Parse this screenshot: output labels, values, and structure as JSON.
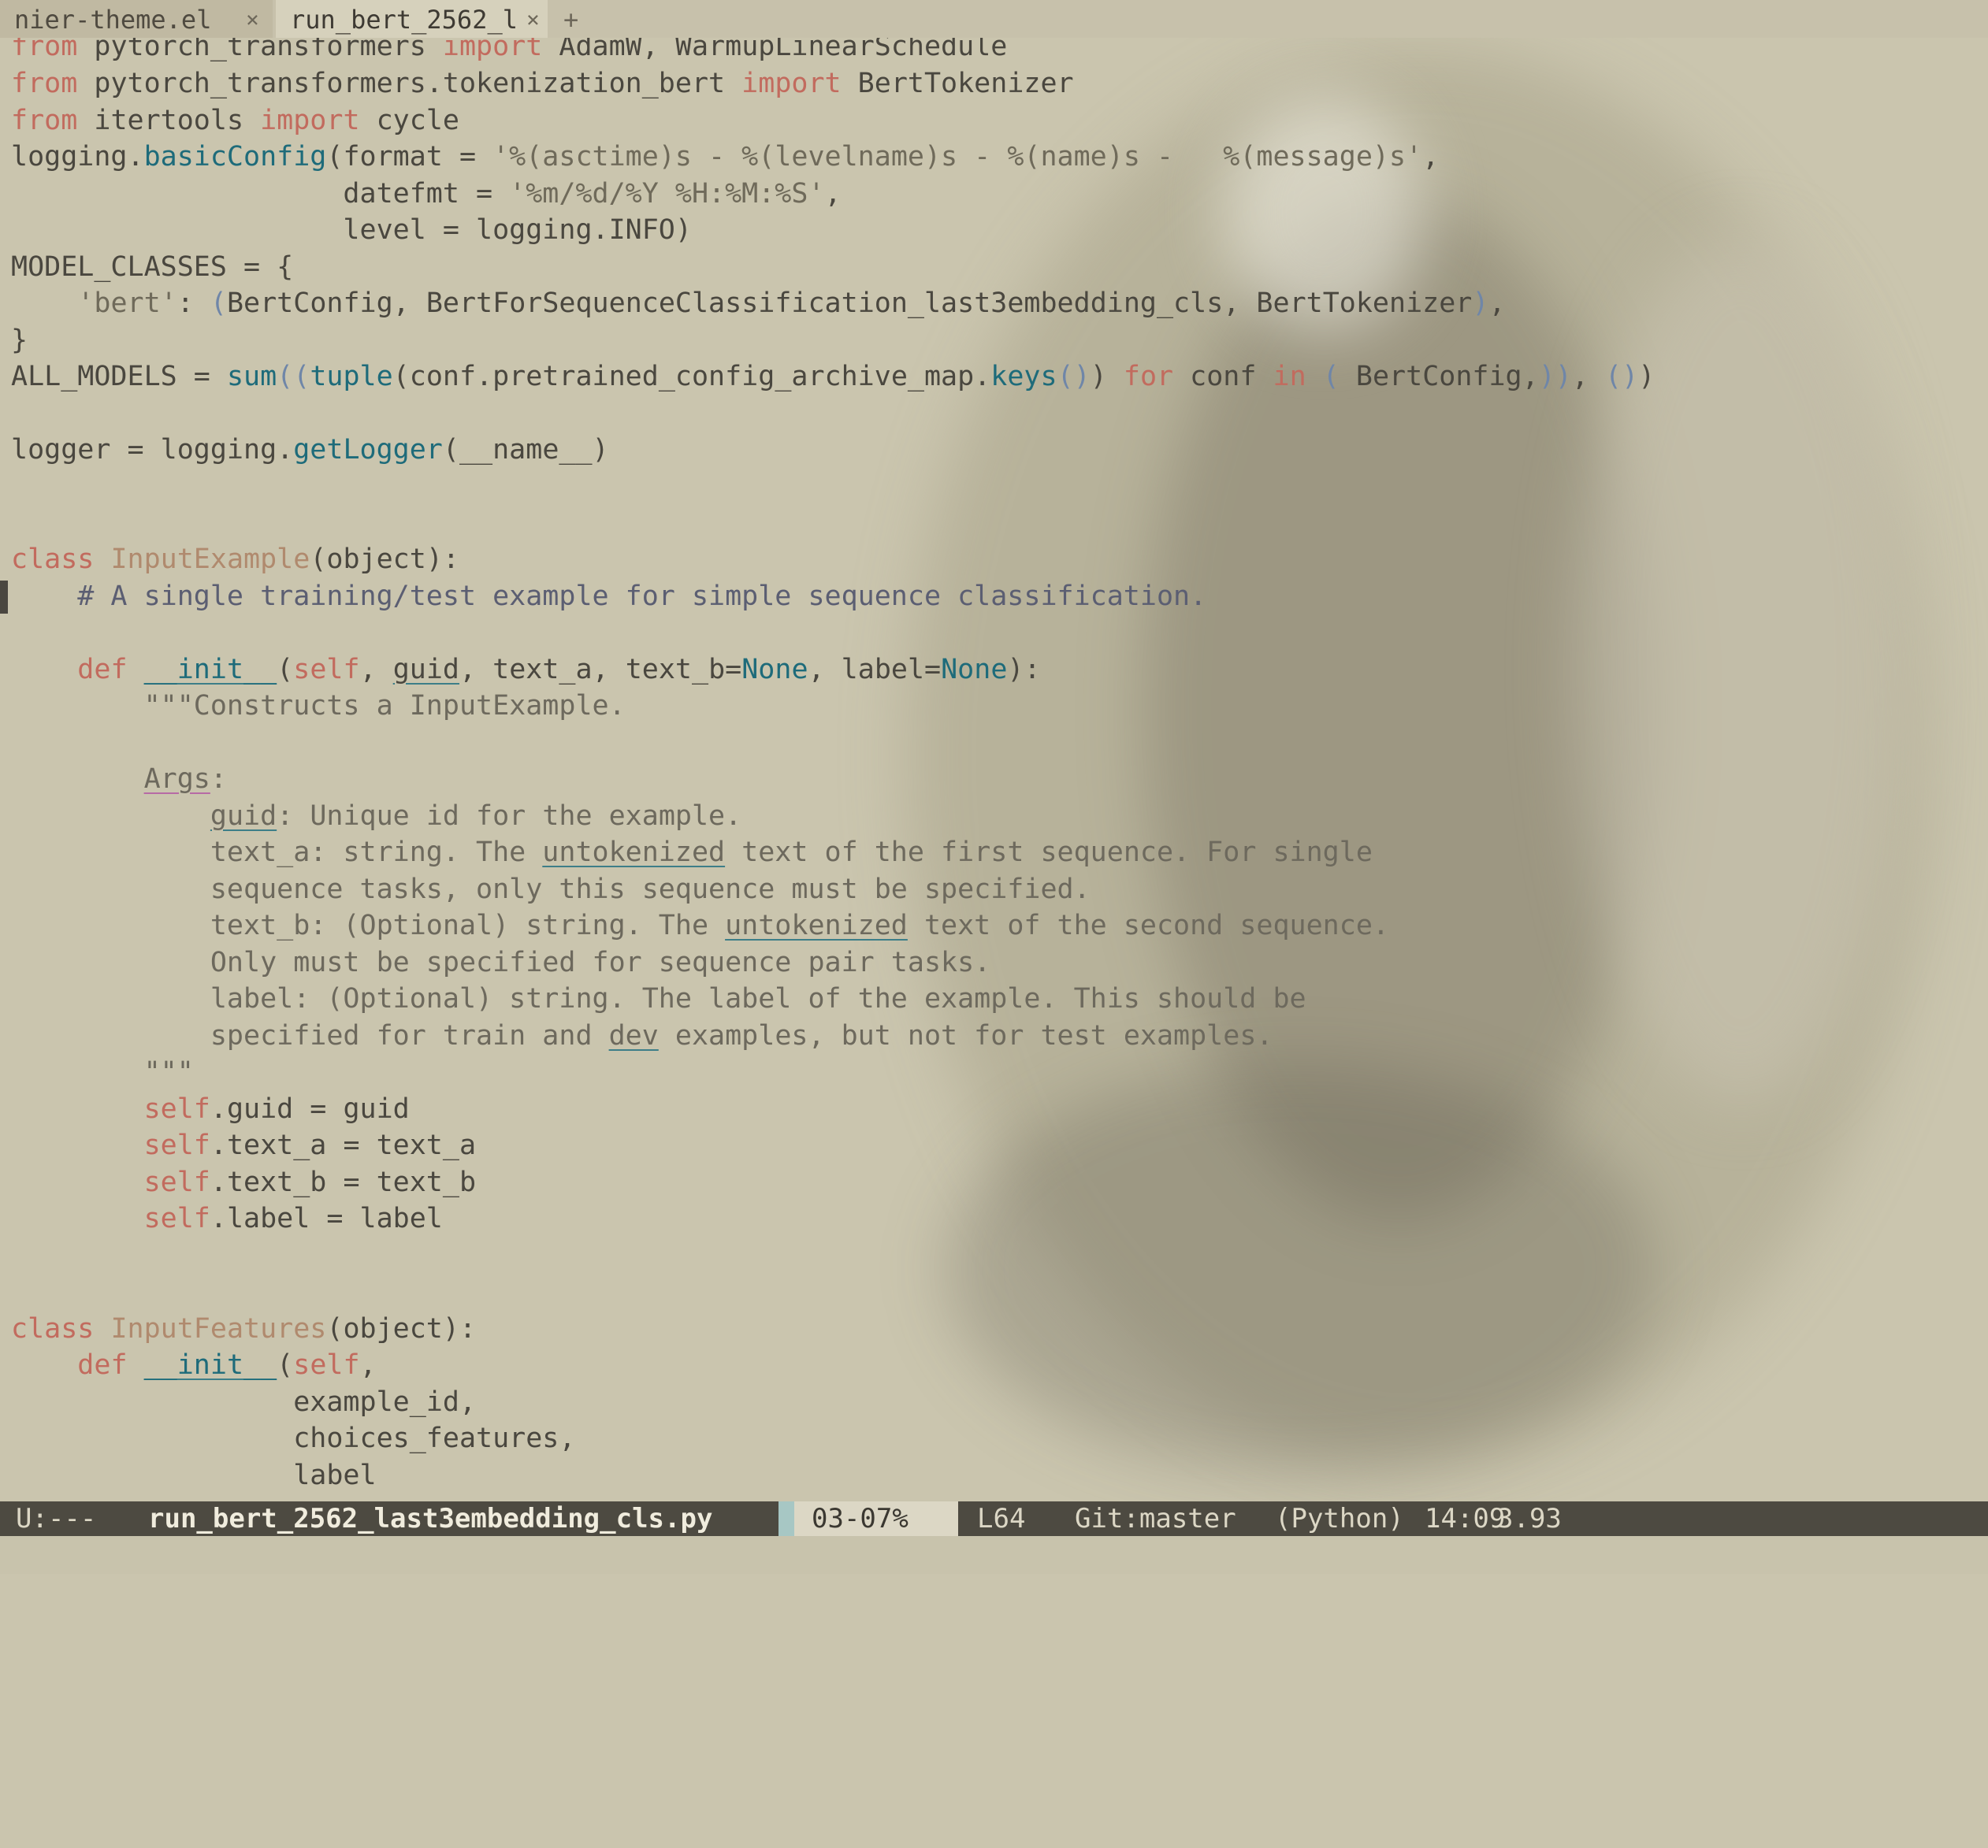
{
  "tabs": [
    {
      "label": "nier-theme.el",
      "close": "×"
    },
    {
      "label": "run_bert_2562_l",
      "close": "×"
    }
  ],
  "new_tab": "+",
  "code_lines": [
    "from pytorch_transformers import AdamW, WarmupLinearSchedule",
    "from pytorch_transformers.tokenization_bert import BertTokenizer",
    "from itertools import cycle",
    "logging.basicConfig(format = '%(asctime)s - %(levelname)s - %(name)s -   %(message)s',",
    "                    datefmt = '%m/%d/%Y %H:%M:%S',",
    "                    level = logging.INFO)",
    "MODEL_CLASSES = {",
    "    'bert': (BertConfig, BertForSequenceClassification_last3embedding_cls, BertTokenizer),",
    "}",
    "ALL_MODELS = sum((tuple(conf.pretrained_config_archive_map.keys()) for conf in ( BertConfig,)), ())",
    "logger = logging.getLogger(__name__)",
    "class InputExample(object):",
    "    # A single training/test example for simple sequence classification.",
    "    def __init__(self, guid, text_a, text_b=None, label=None):",
    "        \"\"\"Constructs a InputExample.",
    "        Args:",
    "            guid: Unique id for the example.",
    "            text_a: string. The untokenized text of the first sequence. For single",
    "            sequence tasks, only this sequence must be specified.",
    "            text_b: (Optional) string. The untokenized text of the second sequence.",
    "            Only must be specified for sequence pair tasks.",
    "            label: (Optional) string. The label of the example. This should be",
    "            specified for train and dev examples, but not for test examples.",
    "        \"\"\"",
    "        self.guid = guid",
    "        self.text_a = text_a",
    "        self.text_b = text_b",
    "        self.label = label",
    "class InputFeatures(object):",
    "    def __init__(self,",
    "                 example_id,",
    "                 choices_features,",
    "                 label"
  ],
  "modeline": {
    "state": "U:---",
    "filename": "run_bert_2562_last3embedding_cls.py",
    "position": "03-07%",
    "line": "L64",
    "git": "Git:master",
    "mode": "(Python)",
    "time": "14:09",
    "load": "3.93"
  },
  "colors": {
    "background": "#cac5ae",
    "keyword": "#c26b5e",
    "function": "#1e6b7a",
    "class_name": "#b08a6e",
    "comment": "#5b5e72",
    "modeline_bg": "#4d4a41"
  }
}
